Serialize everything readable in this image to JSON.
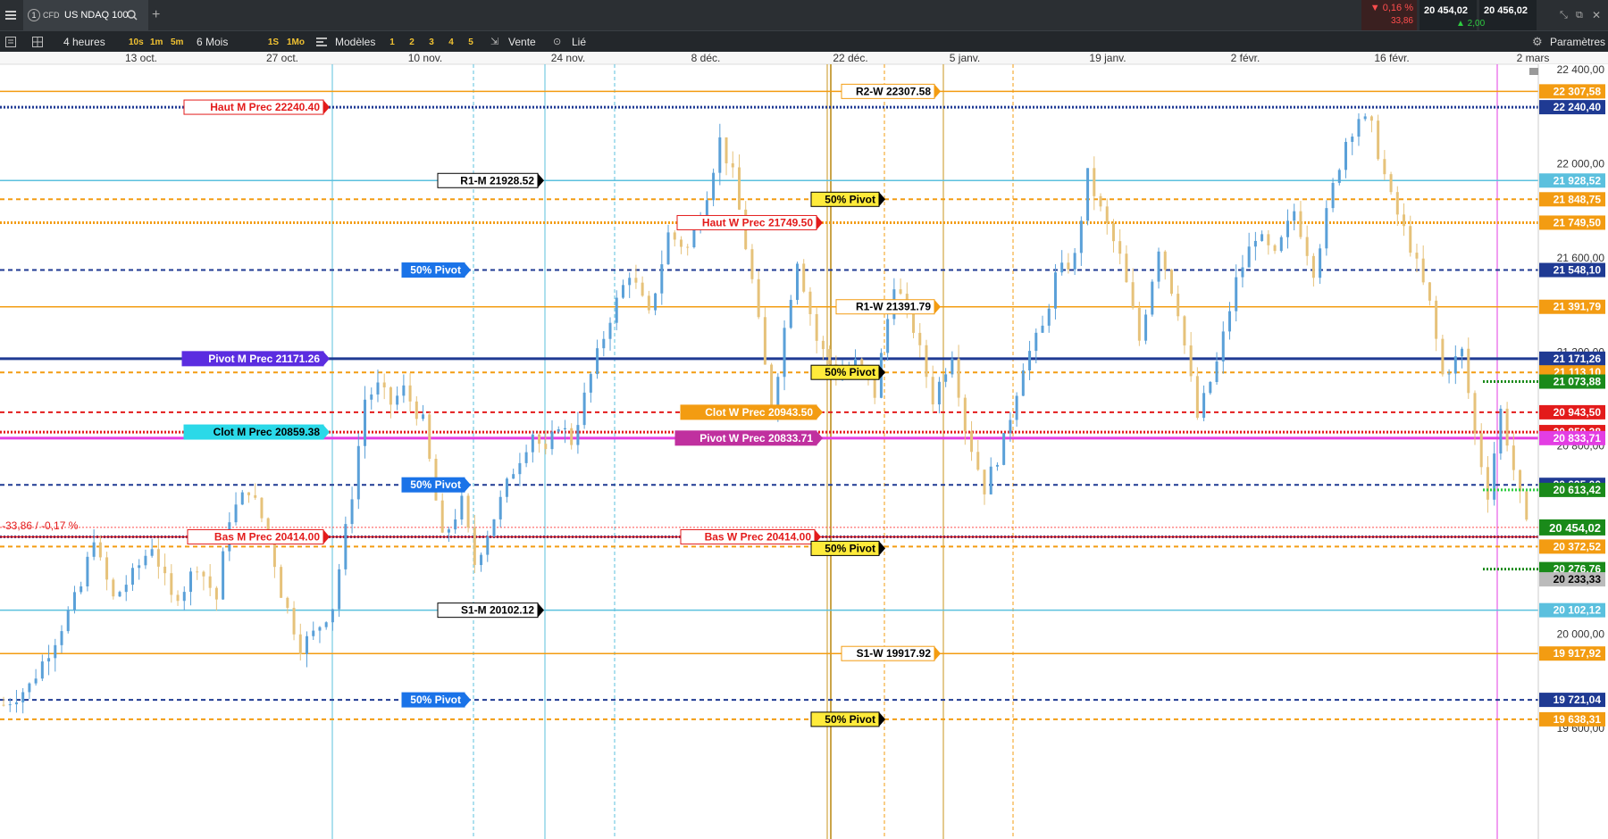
{
  "topbar": {
    "menu_icon": "hamburger-menu-icon",
    "tab_number": "1",
    "instrument_type": "CFD",
    "instrument_name": "US NDAQ 100",
    "search_icon": "search-icon",
    "add_tab_icon": "plus-icon",
    "change_pct": "▼ 0,16 %",
    "change_abs": "33,86",
    "bid": "20 454,02",
    "ask": "20 456,02",
    "spread": "▲ 2,00",
    "spread_color": "#2ecc40",
    "change_color": "#ff4d4d"
  },
  "toolbar": {
    "interval": "4 heures",
    "quick_intervals": [
      "10s",
      "1m",
      "5m"
    ],
    "period": "6 Mois",
    "quick_periods": [
      "1S",
      "1Mo"
    ],
    "templates": "Modèles",
    "template_slots": [
      "1",
      "2",
      "3",
      "4",
      "5"
    ],
    "sell_label": "Vente",
    "linked_label": "Lié",
    "settings_label": "Paramètres"
  },
  "chart_data": {
    "type": "candlestick",
    "title": "",
    "x_ticks": [
      "13 oct.",
      "27 oct.",
      "10 nov.",
      "24 nov.",
      "8 déc.",
      "22 déc.",
      "5 janv.",
      "19 janv.",
      "2 févr.",
      "16 févr.",
      "2 mars"
    ],
    "y_ticks": [
      "22 400,00",
      "22 000,00",
      "21 600,00",
      "21 200,00",
      "20 800,00",
      "20 000,00",
      "19 600,00"
    ],
    "ylim": [
      19540,
      22520
    ],
    "current_price": 20454.02,
    "current_label": "20 454,02",
    "current_change_label": "-33,86 / -0,17 %",
    "close_path": [
      [
        0,
        19700
      ],
      [
        4,
        19780
      ],
      [
        8,
        19980
      ],
      [
        12,
        20200
      ],
      [
        14,
        20420
      ],
      [
        15,
        20300
      ],
      [
        17,
        20150
      ],
      [
        20,
        20250
      ],
      [
        23,
        20380
      ],
      [
        26,
        20150
      ],
      [
        28,
        20200
      ],
      [
        30,
        20300
      ],
      [
        33,
        20150
      ],
      [
        35,
        20500
      ],
      [
        38,
        20620
      ],
      [
        41,
        20430
      ],
      [
        43,
        20180
      ],
      [
        46,
        19950
      ],
      [
        48,
        20000
      ],
      [
        51,
        20120
      ],
      [
        54,
        20600
      ],
      [
        56,
        21000
      ],
      [
        58,
        21050
      ],
      [
        60,
        20980
      ],
      [
        62,
        21040
      ],
      [
        65,
        20900
      ],
      [
        68,
        20400
      ],
      [
        71,
        20560
      ],
      [
        73,
        20300
      ],
      [
        76,
        20500
      ],
      [
        79,
        20700
      ],
      [
        82,
        20860
      ],
      [
        84,
        20760
      ],
      [
        86,
        20900
      ],
      [
        88,
        20820
      ],
      [
        91,
        21100
      ],
      [
        94,
        21350
      ],
      [
        97,
        21540
      ],
      [
        100,
        21350
      ],
      [
        103,
        21700
      ],
      [
        106,
        21640
      ],
      [
        109,
        21880
      ],
      [
        111,
        22100
      ],
      [
        113,
        21950
      ],
      [
        116,
        21500
      ],
      [
        119,
        20950
      ],
      [
        121,
        21300
      ],
      [
        123,
        21600
      ],
      [
        126,
        21250
      ],
      [
        129,
        21100
      ],
      [
        132,
        21150
      ],
      [
        135,
        21020
      ],
      [
        138,
        21500
      ],
      [
        141,
        21300
      ],
      [
        144,
        21000
      ],
      [
        147,
        21200
      ],
      [
        149,
        20880
      ],
      [
        152,
        20620
      ],
      [
        155,
        20820
      ],
      [
        158,
        21150
      ],
      [
        161,
        21300
      ],
      [
        163,
        21520
      ],
      [
        166,
        21600
      ],
      [
        168,
        21950
      ],
      [
        170,
        21800
      ],
      [
        173,
        21600
      ],
      [
        176,
        21250
      ],
      [
        179,
        21650
      ],
      [
        182,
        21380
      ],
      [
        185,
        20920
      ],
      [
        188,
        21150
      ],
      [
        191,
        21500
      ],
      [
        194,
        21700
      ],
      [
        197,
        21600
      ],
      [
        200,
        21800
      ],
      [
        203,
        21550
      ],
      [
        206,
        21900
      ],
      [
        208,
        22100
      ],
      [
        210,
        22200
      ],
      [
        212,
        22150
      ],
      [
        215,
        21850
      ],
      [
        218,
        21650
      ],
      [
        221,
        21400
      ],
      [
        223,
        21100
      ],
      [
        226,
        21200
      ],
      [
        228,
        20850
      ],
      [
        230,
        20600
      ],
      [
        232,
        20950
      ],
      [
        234,
        20700
      ],
      [
        236,
        20454
      ]
    ],
    "levels": [
      {
        "name": "R2-W",
        "value": 22307.58,
        "label": "R2-W  22307.58",
        "axis_label": "22 307,58",
        "color": "#f39c12",
        "style": "solid"
      },
      {
        "name": "Haut M Prec",
        "value": 22240.4,
        "label": "Haut  M  Prec  22240.40",
        "axis_label": "22 240,40",
        "color": "#1f3a93",
        "style": "dotted"
      },
      {
        "name": "R1-M",
        "value": 21928.52,
        "label": "R1-M  21928.52",
        "axis_label": "21 928,52",
        "color": "#5bc0de",
        "style": "solid"
      },
      {
        "name": "50% Pivot",
        "value": 21848.75,
        "label": "50% Pivot",
        "axis_label": "21 848,75",
        "color": "#f39c12",
        "style": "dashed"
      },
      {
        "name": "Haut W Prec",
        "value": 21749.5,
        "label": "Haut  W  Prec  21749.50",
        "axis_label": "21 749,50",
        "color": "#f39c12",
        "style": "dotted"
      },
      {
        "name": "50% Pivot",
        "value": 21548.1,
        "label": "50% Pivot",
        "axis_label": "21 548,10",
        "color": "#1f3a93",
        "style": "dashed"
      },
      {
        "name": "R1-W",
        "value": 21391.79,
        "label": "R1-W   21391.79",
        "axis_label": "21 391,79",
        "color": "#f39c12",
        "style": "solid"
      },
      {
        "name": "Pivot M Prec",
        "value": 21171.26,
        "label": "Pivot  M  Prec  21171.26",
        "axis_label": "21 171,26",
        "color": "#1f3a93",
        "style": "solid"
      },
      {
        "name": "50% Pivot",
        "value": 21113.1,
        "label": "50% Pivot",
        "axis_label": "21 113,10",
        "color": "#f39c12",
        "style": "dashed"
      },
      {
        "name": "Clot W Prec",
        "value": 20943.5,
        "label": "Clot  W  Prec  20943.50",
        "axis_label": "20 943,50",
        "color": "#e31b1b",
        "style": "dashed"
      },
      {
        "name": "Clot M Prec",
        "value": 20859.38,
        "label": "Clot  M  Prec  20859.38",
        "axis_label": "20 859,38",
        "color": "#e31b1b",
        "style": "dotted"
      },
      {
        "name": "Pivot W Prec",
        "value": 20833.71,
        "label": "Pivot  W  Prec  20833.71",
        "axis_label": "20 833,71",
        "color": "#e33ee3",
        "style": "solid"
      },
      {
        "name": "50% Pivot",
        "value": 20635.0,
        "label": "50% Pivot",
        "axis_label": "20 635,00",
        "color": "#1f3a93",
        "style": "dashed"
      },
      {
        "name": "Bas M Prec",
        "value": 20414.0,
        "label": "Bas  M  Prec  20414.00",
        "axis_label": "",
        "color": "#1f3a93",
        "style": "dotted"
      },
      {
        "name": "Bas W Prec",
        "value": 20414.0,
        "label": "Bas  W  Prec  20414.00",
        "axis_label": "",
        "color": "#e31b1b",
        "style": "solid"
      },
      {
        "name": "50% Pivot",
        "value": 20372.52,
        "label": "50% Pivot",
        "axis_label": "20 372,52",
        "color": "#f39c12",
        "style": "dashed"
      },
      {
        "name": "S1-M",
        "value": 20102.12,
        "label": "S1-M  20102.12",
        "axis_label": "20 102,12",
        "color": "#5bc0de",
        "style": "solid"
      },
      {
        "name": "S1-W",
        "value": 19917.92,
        "label": "S1-W  19917.92",
        "axis_label": "19 917,92",
        "color": "#f39c12",
        "style": "solid"
      },
      {
        "name": "50% Pivot",
        "value": 19721.04,
        "label": "50% Pivot",
        "axis_label": "19 721,04",
        "color": "#1f3a93",
        "style": "dashed"
      },
      {
        "name": "50% Pivot",
        "value": 19638.31,
        "label": "50% Pivot",
        "axis_label": "19 638,31",
        "color": "#f39c12",
        "style": "dashed"
      }
    ],
    "extra_axis_labels": [
      {
        "value": 21073.88,
        "label": "21 073,88",
        "color": "#1a8a1a"
      },
      {
        "value": 20613.42,
        "label": "20 613,42",
        "color": "#1a8a1a"
      },
      {
        "value": 20276.76,
        "label": "20 276,76",
        "color": "#1a8a1a"
      },
      {
        "value": 20233.33,
        "label": "20 233,33",
        "color": "#bbbbbb"
      }
    ]
  }
}
